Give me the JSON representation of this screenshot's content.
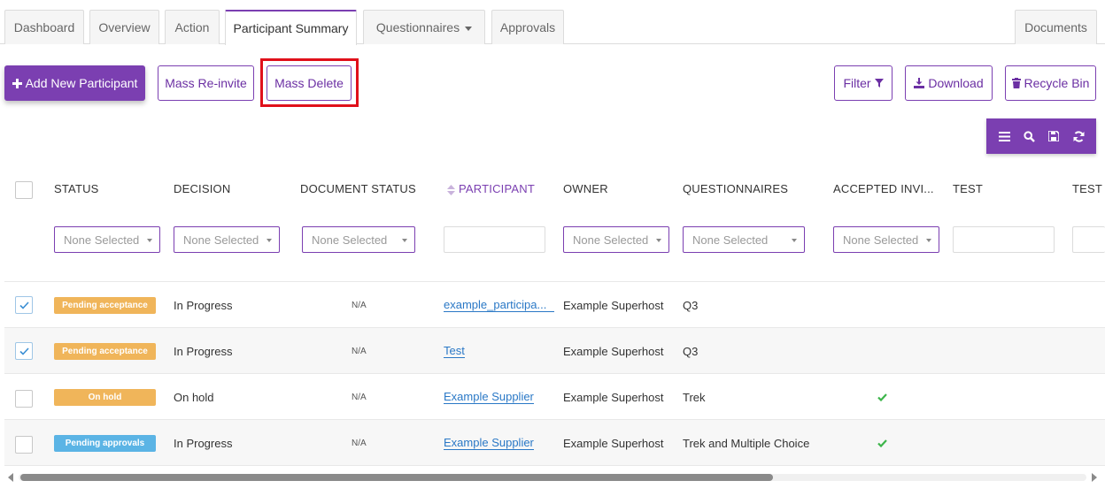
{
  "tabs": [
    {
      "label": "Dashboard"
    },
    {
      "label": "Overview"
    },
    {
      "label": "Action"
    },
    {
      "label": "Participant Summary",
      "active": true
    },
    {
      "label": "Questionnaires",
      "dropdown": true
    },
    {
      "label": "Approvals"
    },
    {
      "label": "Documents"
    }
  ],
  "toolbar": {
    "add_label": "Add New Participant",
    "reinvite_label": "Mass Re-invite",
    "delete_label": "Mass Delete",
    "filter_label": "Filter",
    "download_label": "Download",
    "recycle_label": "Recycle Bin"
  },
  "table": {
    "columns": [
      "STATUS",
      "DECISION",
      "DOCUMENT STATUS",
      "PARTICIPANT",
      "OWNER",
      "QUESTIONNAIRES",
      "ACCEPTED INVI...",
      "TEST",
      "TEST"
    ],
    "filter_placeholder": "None Selected",
    "rows": [
      {
        "checked": true,
        "status": "Pending acceptance",
        "status_color": "#f0b55a",
        "decision": "In Progress",
        "doc_status": "N/A",
        "participant": "example_participa...",
        "owner": "Example Superhost",
        "questionnaires": "Q3",
        "accepted": false
      },
      {
        "checked": true,
        "status": "Pending acceptance",
        "status_color": "#f0b55a",
        "decision": "In Progress",
        "doc_status": "N/A",
        "participant": "Test",
        "owner": "Example Superhost",
        "questionnaires": "Q3",
        "accepted": false
      },
      {
        "checked": false,
        "status": "On hold",
        "status_color": "#f0b55a",
        "decision": "On hold",
        "doc_status": "N/A",
        "participant": "Example Supplier",
        "owner": "Example Superhost",
        "questionnaires": "Trek",
        "accepted": true
      },
      {
        "checked": false,
        "status": "Pending approvals",
        "status_color": "#5bb4e5",
        "decision": "In Progress",
        "doc_status": "N/A",
        "participant": "Example Supplier",
        "owner": "Example Superhost",
        "questionnaires": "Trek and Multiple Choice",
        "accepted": true
      }
    ]
  },
  "colors": {
    "accent": "#7b3fb1",
    "link": "#2a78c6",
    "highlight": "#e0101a",
    "check": "#3cb54a"
  }
}
